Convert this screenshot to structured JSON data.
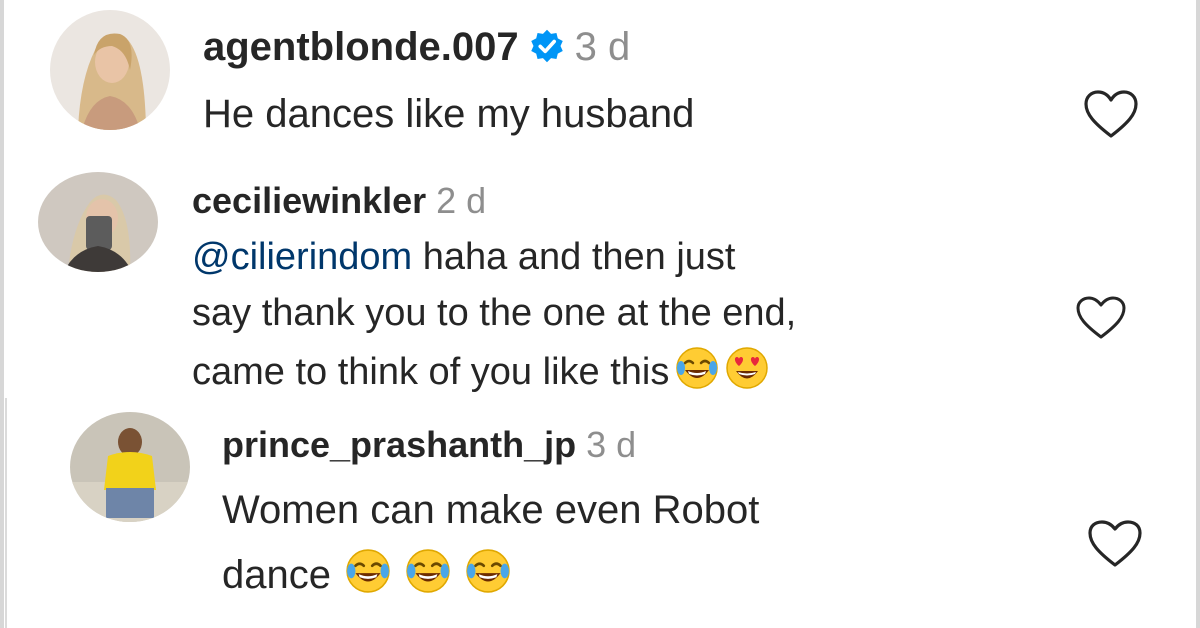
{
  "comments": [
    {
      "username": "agentblonde.007",
      "verified": true,
      "timestamp": "3 d",
      "text": "He dances like my husband",
      "avatar_icon": "profile-photo-blonde-woman",
      "like_icon": "heart-outline-icon"
    },
    {
      "username": "ceciliewinkler",
      "verified": false,
      "timestamp": "2 d",
      "mention": "@cilierindom",
      "text_line1": " haha and then just",
      "text_line2": "say thank you to the one at the end,",
      "text_line3": "came to think of you like this",
      "emojis": [
        "face-with-tears-of-joy",
        "smiling-face-with-heart-eyes"
      ],
      "avatar_icon": "profile-photo-woman-mirror-selfie",
      "like_icon": "heart-outline-icon"
    },
    {
      "username": "prince_prashanth_jp",
      "verified": false,
      "timestamp": "3 d",
      "text_line1": "Women can make even Robot",
      "text_line2": "dance",
      "emojis": [
        "face-with-tears-of-joy",
        "face-with-tears-of-joy",
        "face-with-tears-of-joy"
      ],
      "avatar_icon": "profile-photo-man-yellow-shirt",
      "like_icon": "heart-outline-icon"
    }
  ],
  "colors": {
    "text": "#262626",
    "secondary": "#8e8e8e",
    "mention": "#00376b",
    "verified": "#0095f6",
    "emoji_face": "#ffcc33",
    "emoji_tear": "#4aa6e8"
  }
}
